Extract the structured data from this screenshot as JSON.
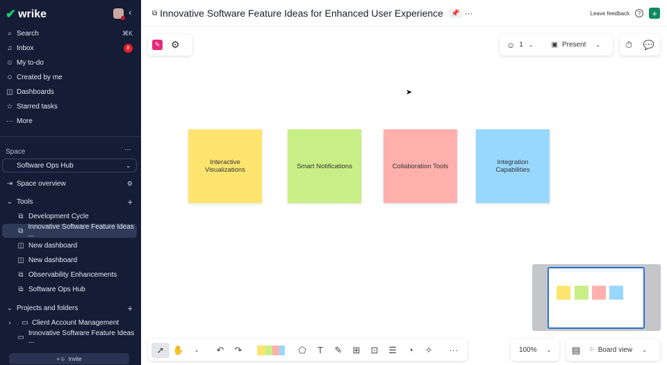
{
  "sidebar": {
    "brand": "wrike",
    "nav": [
      {
        "label": "Search",
        "icon": "search-icon",
        "shortcut": "⌘K"
      },
      {
        "label": "Inbox",
        "icon": "bell-icon",
        "badge": "8"
      },
      {
        "label": "My to-do",
        "icon": "user-todo-icon"
      },
      {
        "label": "Created by me",
        "icon": "user-plus-icon"
      },
      {
        "label": "Dashboards",
        "icon": "dashboard-icon"
      },
      {
        "label": "Starred tasks",
        "icon": "star-icon"
      },
      {
        "label": "More",
        "icon": "more-icon"
      }
    ],
    "space_label": "Space",
    "space_selected": "Software Ops Hub",
    "space_overview": "Space overview",
    "tools_label": "Tools",
    "tools": [
      "Development Cycle",
      "Innovative Software Feature Ideas ...",
      "New dashboard",
      "New dashboard",
      "Observability Enhancements",
      "Software Ops Hub"
    ],
    "projects_label": "Projects and folders",
    "projects": [
      "Client Account Management",
      "Innovative Software Feature Ideas ..."
    ],
    "invite": "Invite"
  },
  "header": {
    "title": "Innovative Software Feature Ideas for Enhanced User Experience",
    "feedback": "Leave feedback"
  },
  "toolbar": {
    "users_count": "1",
    "present": "Present",
    "zoom": "100%",
    "view": "Board view"
  },
  "stickies": [
    {
      "text": "Interactive Visualizations",
      "color": "#fde46f"
    },
    {
      "text": "Smart Notifications",
      "color": "#c8ef86"
    },
    {
      "text": "Collaboration Tools",
      "color": "#ffb0ad"
    },
    {
      "text": "Integration Capabilities",
      "color": "#98d8ff"
    }
  ]
}
